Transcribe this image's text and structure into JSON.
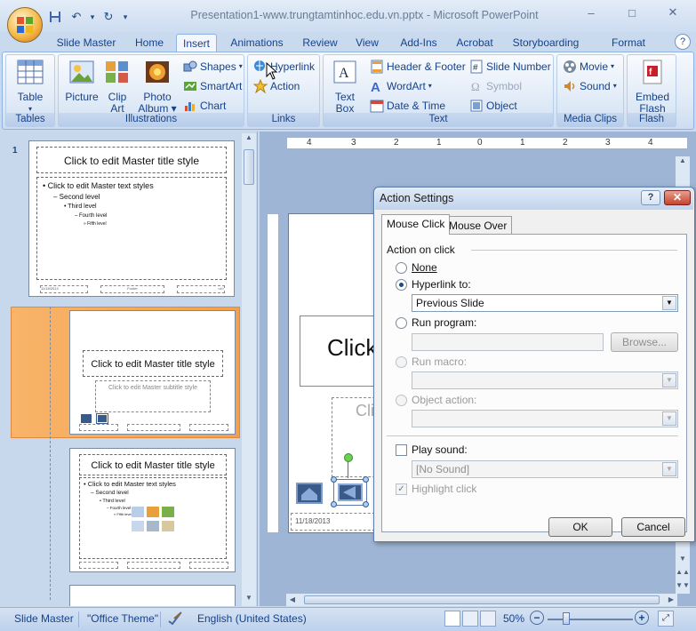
{
  "window": {
    "title": "Presentation1-www.trungtamtinhoc.edu.vn.pptx - Microsoft PowerPoint",
    "min": "–",
    "max": "□",
    "close": "✕"
  },
  "qat": {
    "save": "save-icon",
    "undo": "↶",
    "dropdown": "▾",
    "redo": "↻",
    "customize": "▾"
  },
  "tabs": [
    {
      "label": "Slide Master"
    },
    {
      "label": "Home"
    },
    {
      "label": "Insert"
    },
    {
      "label": "Animations"
    },
    {
      "label": "Review"
    },
    {
      "label": "View"
    },
    {
      "label": "Add-Ins"
    },
    {
      "label": "Acrobat"
    },
    {
      "label": "Storyboarding"
    },
    {
      "label": "Format"
    }
  ],
  "help": "?",
  "ribbon": {
    "tables": {
      "label": "Tables",
      "table": "Table"
    },
    "illustrations": {
      "label": "Illustrations",
      "picture": "Picture",
      "clip": "Clip",
      "art": "Art",
      "photo": "Photo",
      "album": "Album",
      "shapes": "Shapes",
      "smartart": "SmartArt",
      "chart": "Chart"
    },
    "links": {
      "label": "Links",
      "hyperlink": "Hyperlink",
      "action": "Action"
    },
    "text": {
      "label": "Text",
      "textbox1": "Text",
      "textbox2": "Box",
      "header_footer": "Header & Footer",
      "wordart": "WordArt",
      "date_time": "Date & Time",
      "slide_number": "Slide Number",
      "symbol": "Symbol",
      "object": "Object"
    },
    "media": {
      "label": "Media Clips",
      "movie": "Movie",
      "sound": "Sound"
    },
    "flash": {
      "label": "Flash",
      "embed": "Embed",
      "flash": "Flash"
    }
  },
  "slides_pane": {
    "slide_number": "1",
    "thumb1": {
      "title": "Click to edit Master title style",
      "bullets": [
        "Click to edit Master text styles",
        "Second level",
        "Third level",
        "Fourth level",
        "Fifth level"
      ],
      "date": "11/18/2013",
      "footer": "Footer",
      "num": "<#>"
    },
    "thumb2": {
      "title": "Click to edit Master title style",
      "subtitle": "Click to edit Master subtitle style"
    },
    "thumb3": {
      "title": "Click to edit Master title style",
      "bullets": [
        "Click to edit Master text styles",
        "Second level",
        "Third level",
        "Fourth level",
        "Fifth level"
      ]
    }
  },
  "canvas": {
    "title_fragment": "Click",
    "subtitle_fragment": "Cli",
    "date": "11/18/2013",
    "ruler_labels": [
      "4",
      "3",
      "2",
      "1",
      "0",
      "1",
      "2",
      "3",
      "4"
    ]
  },
  "status": {
    "view": "Slide Master",
    "theme": "\"Office Theme\"",
    "language": "English (United States)",
    "zoom": "50%",
    "zoom_level_percent": 50
  },
  "dialog": {
    "title": "Action Settings",
    "help": "?",
    "close": "✕",
    "tab_mouse_click": "Mouse Click",
    "tab_mouse_over": "Mouse Over",
    "section": "Action on click",
    "none": "None",
    "hyperlink_to": "Hyperlink to:",
    "hyperlink_value": "Previous Slide",
    "run_program": "Run program:",
    "run_program_value": "",
    "browse": "Browse...",
    "run_macro": "Run macro:",
    "object_action": "Object action:",
    "play_sound": "Play sound:",
    "sound_value": "[No Sound]",
    "highlight_click": "Highlight click",
    "ok": "OK",
    "cancel": "Cancel"
  }
}
